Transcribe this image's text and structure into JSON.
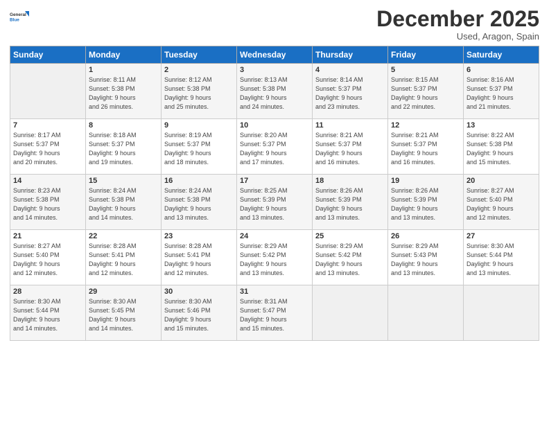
{
  "header": {
    "logo_general": "General",
    "logo_blue": "Blue",
    "month_title": "December 2025",
    "location": "Used, Aragon, Spain"
  },
  "days_of_week": [
    "Sunday",
    "Monday",
    "Tuesday",
    "Wednesday",
    "Thursday",
    "Friday",
    "Saturday"
  ],
  "weeks": [
    [
      {
        "num": "",
        "sunrise": "",
        "sunset": "",
        "daylight": ""
      },
      {
        "num": "1",
        "sunrise": "Sunrise: 8:11 AM",
        "sunset": "Sunset: 5:38 PM",
        "daylight": "Daylight: 9 hours and 26 minutes."
      },
      {
        "num": "2",
        "sunrise": "Sunrise: 8:12 AM",
        "sunset": "Sunset: 5:38 PM",
        "daylight": "Daylight: 9 hours and 25 minutes."
      },
      {
        "num": "3",
        "sunrise": "Sunrise: 8:13 AM",
        "sunset": "Sunset: 5:38 PM",
        "daylight": "Daylight: 9 hours and 24 minutes."
      },
      {
        "num": "4",
        "sunrise": "Sunrise: 8:14 AM",
        "sunset": "Sunset: 5:37 PM",
        "daylight": "Daylight: 9 hours and 23 minutes."
      },
      {
        "num": "5",
        "sunrise": "Sunrise: 8:15 AM",
        "sunset": "Sunset: 5:37 PM",
        "daylight": "Daylight: 9 hours and 22 minutes."
      },
      {
        "num": "6",
        "sunrise": "Sunrise: 8:16 AM",
        "sunset": "Sunset: 5:37 PM",
        "daylight": "Daylight: 9 hours and 21 minutes."
      }
    ],
    [
      {
        "num": "7",
        "sunrise": "Sunrise: 8:17 AM",
        "sunset": "Sunset: 5:37 PM",
        "daylight": "Daylight: 9 hours and 20 minutes."
      },
      {
        "num": "8",
        "sunrise": "Sunrise: 8:18 AM",
        "sunset": "Sunset: 5:37 PM",
        "daylight": "Daylight: 9 hours and 19 minutes."
      },
      {
        "num": "9",
        "sunrise": "Sunrise: 8:19 AM",
        "sunset": "Sunset: 5:37 PM",
        "daylight": "Daylight: 9 hours and 18 minutes."
      },
      {
        "num": "10",
        "sunrise": "Sunrise: 8:20 AM",
        "sunset": "Sunset: 5:37 PM",
        "daylight": "Daylight: 9 hours and 17 minutes."
      },
      {
        "num": "11",
        "sunrise": "Sunrise: 8:21 AM",
        "sunset": "Sunset: 5:37 PM",
        "daylight": "Daylight: 9 hours and 16 minutes."
      },
      {
        "num": "12",
        "sunrise": "Sunrise: 8:21 AM",
        "sunset": "Sunset: 5:37 PM",
        "daylight": "Daylight: 9 hours and 16 minutes."
      },
      {
        "num": "13",
        "sunrise": "Sunrise: 8:22 AM",
        "sunset": "Sunset: 5:38 PM",
        "daylight": "Daylight: 9 hours and 15 minutes."
      }
    ],
    [
      {
        "num": "14",
        "sunrise": "Sunrise: 8:23 AM",
        "sunset": "Sunset: 5:38 PM",
        "daylight": "Daylight: 9 hours and 14 minutes."
      },
      {
        "num": "15",
        "sunrise": "Sunrise: 8:24 AM",
        "sunset": "Sunset: 5:38 PM",
        "daylight": "Daylight: 9 hours and 14 minutes."
      },
      {
        "num": "16",
        "sunrise": "Sunrise: 8:24 AM",
        "sunset": "Sunset: 5:38 PM",
        "daylight": "Daylight: 9 hours and 13 minutes."
      },
      {
        "num": "17",
        "sunrise": "Sunrise: 8:25 AM",
        "sunset": "Sunset: 5:39 PM",
        "daylight": "Daylight: 9 hours and 13 minutes."
      },
      {
        "num": "18",
        "sunrise": "Sunrise: 8:26 AM",
        "sunset": "Sunset: 5:39 PM",
        "daylight": "Daylight: 9 hours and 13 minutes."
      },
      {
        "num": "19",
        "sunrise": "Sunrise: 8:26 AM",
        "sunset": "Sunset: 5:39 PM",
        "daylight": "Daylight: 9 hours and 13 minutes."
      },
      {
        "num": "20",
        "sunrise": "Sunrise: 8:27 AM",
        "sunset": "Sunset: 5:40 PM",
        "daylight": "Daylight: 9 hours and 12 minutes."
      }
    ],
    [
      {
        "num": "21",
        "sunrise": "Sunrise: 8:27 AM",
        "sunset": "Sunset: 5:40 PM",
        "daylight": "Daylight: 9 hours and 12 minutes."
      },
      {
        "num": "22",
        "sunrise": "Sunrise: 8:28 AM",
        "sunset": "Sunset: 5:41 PM",
        "daylight": "Daylight: 9 hours and 12 minutes."
      },
      {
        "num": "23",
        "sunrise": "Sunrise: 8:28 AM",
        "sunset": "Sunset: 5:41 PM",
        "daylight": "Daylight: 9 hours and 12 minutes."
      },
      {
        "num": "24",
        "sunrise": "Sunrise: 8:29 AM",
        "sunset": "Sunset: 5:42 PM",
        "daylight": "Daylight: 9 hours and 13 minutes."
      },
      {
        "num": "25",
        "sunrise": "Sunrise: 8:29 AM",
        "sunset": "Sunset: 5:42 PM",
        "daylight": "Daylight: 9 hours and 13 minutes."
      },
      {
        "num": "26",
        "sunrise": "Sunrise: 8:29 AM",
        "sunset": "Sunset: 5:43 PM",
        "daylight": "Daylight: 9 hours and 13 minutes."
      },
      {
        "num": "27",
        "sunrise": "Sunrise: 8:30 AM",
        "sunset": "Sunset: 5:44 PM",
        "daylight": "Daylight: 9 hours and 13 minutes."
      }
    ],
    [
      {
        "num": "28",
        "sunrise": "Sunrise: 8:30 AM",
        "sunset": "Sunset: 5:44 PM",
        "daylight": "Daylight: 9 hours and 14 minutes."
      },
      {
        "num": "29",
        "sunrise": "Sunrise: 8:30 AM",
        "sunset": "Sunset: 5:45 PM",
        "daylight": "Daylight: 9 hours and 14 minutes."
      },
      {
        "num": "30",
        "sunrise": "Sunrise: 8:30 AM",
        "sunset": "Sunset: 5:46 PM",
        "daylight": "Daylight: 9 hours and 15 minutes."
      },
      {
        "num": "31",
        "sunrise": "Sunrise: 8:31 AM",
        "sunset": "Sunset: 5:47 PM",
        "daylight": "Daylight: 9 hours and 15 minutes."
      },
      {
        "num": "",
        "sunrise": "",
        "sunset": "",
        "daylight": ""
      },
      {
        "num": "",
        "sunrise": "",
        "sunset": "",
        "daylight": ""
      },
      {
        "num": "",
        "sunrise": "",
        "sunset": "",
        "daylight": ""
      }
    ]
  ]
}
